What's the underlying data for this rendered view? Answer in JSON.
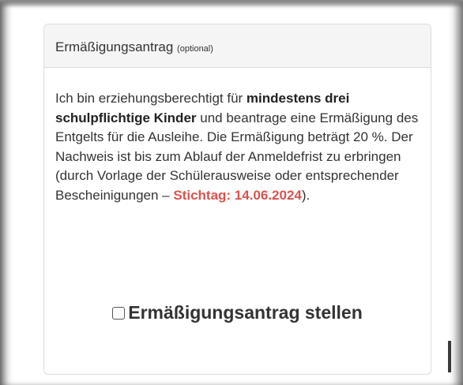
{
  "panel": {
    "title": "Ermäßigungsantrag",
    "title_note": "(optional)",
    "body_parts": {
      "intro": "Ich bin erziehungsberechtigt für ",
      "bold": "mindestens drei schulpflichtige Kinder",
      "middle": " und beantrage eine Ermäßigung des Entgelts für die Ausleihe. Die Ermäßigung beträgt 20 %. Der Nachweis ist bis zum Ablauf der Anmeldefrist zu erbringen (durch Vorlage der Schülerausweise oder entsprechender Bescheinigungen – ",
      "highlight": "Stichtag: 14.06.2024",
      "end": ")."
    },
    "checkbox_label": "Ermäßigungsantrag stellen",
    "checkbox_checked": false
  },
  "colors": {
    "highlight": "#d9534f",
    "heading_bg": "#f5f5f5",
    "border": "#dcdcdc"
  }
}
